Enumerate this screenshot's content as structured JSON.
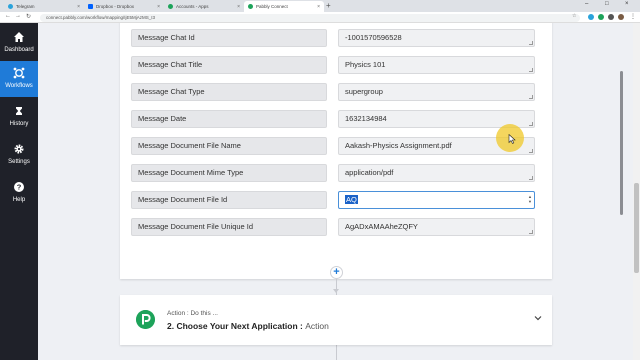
{
  "browser": {
    "tabs": [
      {
        "title": "Telegram",
        "color": "#2aa3db",
        "active": false
      },
      {
        "title": "Dropbox - Dropbox",
        "color": "#0061fe",
        "active": false
      },
      {
        "title": "Accounts - Apps",
        "color": "#1da35a",
        "active": false
      },
      {
        "title": "Pabbly Connect",
        "color": "#1da35a",
        "active": true
      }
    ],
    "new_tab": "+",
    "url": "connect.pabbly.com/workflow/mapping/IjE5MjAzMS_I3"
  },
  "sidebar": {
    "items": [
      {
        "label": "Dashboard",
        "icon": "home-icon",
        "active": false
      },
      {
        "label": "Workflows",
        "icon": "workflows-icon",
        "active": true
      },
      {
        "label": "History",
        "icon": "history-icon",
        "active": false
      },
      {
        "label": "Settings",
        "icon": "gear-icon",
        "active": false
      },
      {
        "label": "Help",
        "icon": "help-icon",
        "active": false
      }
    ],
    "active_color": "#1f7bd8"
  },
  "mapping_rows": [
    {
      "label": "Message Chat Id",
      "value": "-1001570596528"
    },
    {
      "label": "Message Chat Title",
      "value": "Physics 101"
    },
    {
      "label": "Message Chat Type",
      "value": "supergroup"
    },
    {
      "label": "Message Date",
      "value": "1632134984"
    },
    {
      "label": "Message Document File Name",
      "value": "Aakash-Physics Assignment.pdf"
    },
    {
      "label": "Message Document Mime Type",
      "value": "application/pdf"
    },
    {
      "label": "Message Document File Id",
      "value": "AQ"
    },
    {
      "label": "Message Document File Unique Id",
      "value": "AgADxAMAAheZQFY"
    }
  ],
  "action": {
    "subtitle": "Action : Do this ...",
    "title": "2. Choose Your Next Application :",
    "title_suffix": "Action",
    "logo_color": "#1da35a"
  }
}
